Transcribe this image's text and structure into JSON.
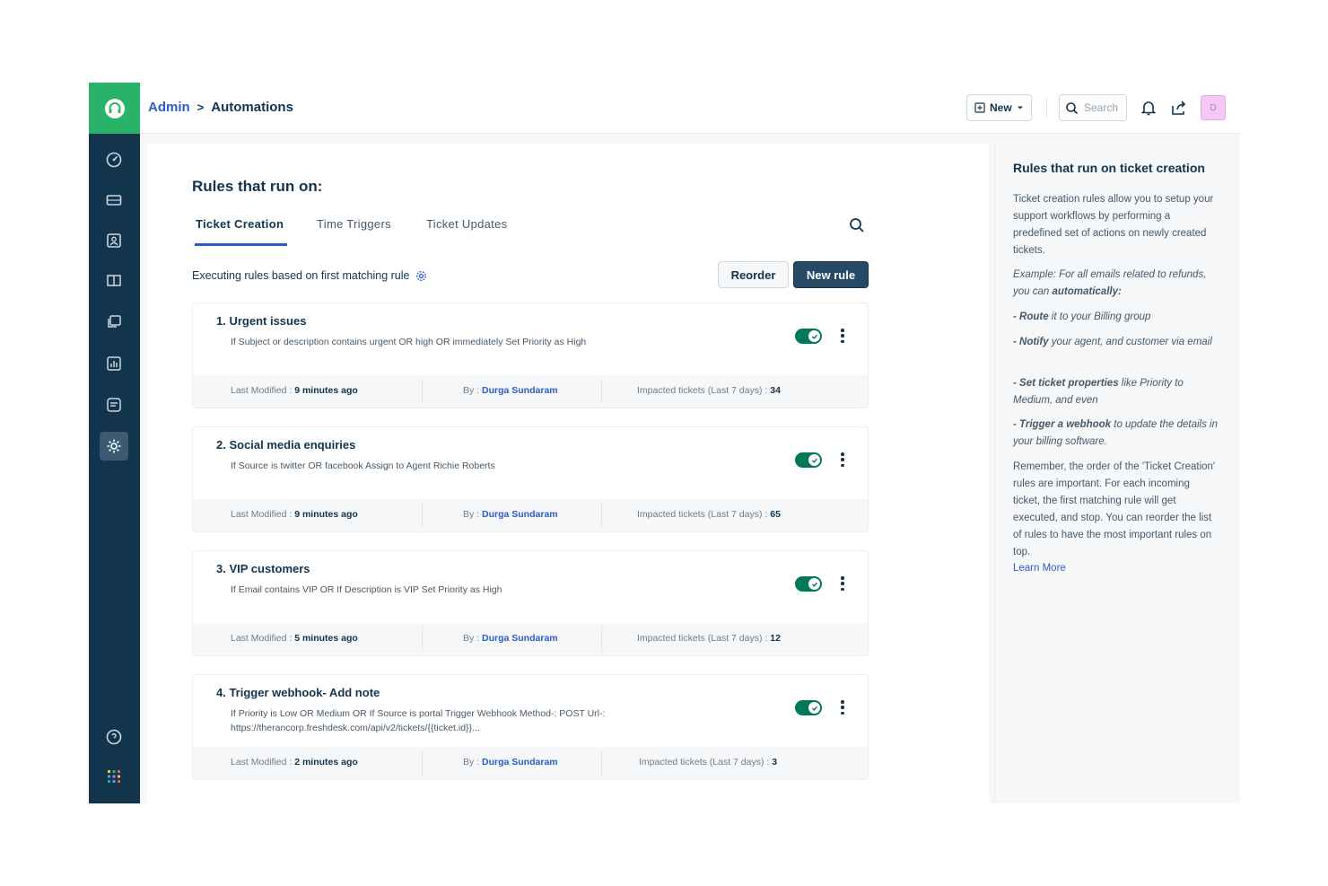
{
  "header": {
    "breadcrumb": {
      "parent": "Admin",
      "separator": ">",
      "current": "Automations"
    },
    "new_label": "New",
    "search_placeholder": "Search",
    "avatar_initial": "D"
  },
  "main": {
    "title": "Rules that run on:",
    "tabs": [
      {
        "label": "Ticket Creation",
        "active": true
      },
      {
        "label": "Time Triggers",
        "active": false
      },
      {
        "label": "Ticket Updates",
        "active": false
      }
    ],
    "exec_text": "Executing rules based on first matching rule",
    "reorder_label": "Reorder",
    "new_rule_label": "New rule",
    "footer_labels": {
      "modified": "Last Modified :",
      "by": "By :",
      "impacted": "Impacted tickets (Last 7 days) :"
    },
    "rules": [
      {
        "name": "1. Urgent issues",
        "condition": "If Subject or description contains urgent OR high OR immediately Set Priority as High",
        "enabled": true,
        "last_modified": "9 minutes ago",
        "by": "Durga Sundaram",
        "impacted": "34"
      },
      {
        "name": "2. Social media enquiries",
        "condition": "If Source is twitter OR facebook Assign to Agent Richie Roberts",
        "enabled": true,
        "last_modified": "9 minutes ago",
        "by": "Durga Sundaram",
        "impacted": "65"
      },
      {
        "name": "3. VIP customers",
        "condition": "If Email contains VIP OR If Description is VIP Set Priority as High",
        "enabled": true,
        "last_modified": "5 minutes ago",
        "by": "Durga Sundaram",
        "impacted": "12"
      },
      {
        "name": "4. Trigger webhook- Add note",
        "condition": "If Priority is Low OR Medium OR If Source is portal Trigger Webhook Method-: POST Url-: https://therancorp.freshdesk.com/api/v2/tickets/{{ticket.id}}...",
        "enabled": true,
        "last_modified": "2 minutes ago",
        "by": "Durga Sundaram",
        "impacted": "3"
      }
    ]
  },
  "help": {
    "title": "Rules that run on ticket creation",
    "intro": "Ticket creation rules allow you to setup your support workflows by performing a predefined set of actions on newly created tickets.",
    "example_prefix": "Example: For all emails related to refunds, you can ",
    "example_bold": "automatically:",
    "bullets": [
      {
        "bold": "- Route",
        "rest": " it to your Billing group"
      },
      {
        "bold": "- Notify",
        "rest": " your agent, and customer via email"
      },
      {
        "bold": "- Set ticket properties",
        "rest": " like Priority to Medium, and even"
      },
      {
        "bold": "- Trigger a webhook",
        "rest": " to update the details in your billing software."
      }
    ],
    "remember": "Remember, the order of the 'Ticket Creation' rules are important. For each incoming ticket, the first matching rule will get executed, and stop. You can reorder the list of rules to have the most important rules on top.",
    "learn_more": "Learn More"
  },
  "colors": {
    "sidebar": "#12344d",
    "brand_green": "#29b36a",
    "accent_blue": "#2c5cc5",
    "toggle_on": "#00795b"
  },
  "icons": {
    "sidebar": [
      "dashboard-icon",
      "tickets-icon",
      "contacts-icon",
      "solutions-icon",
      "forums-icon",
      "reports-icon",
      "discussions-icon",
      "admin-icon",
      "help-icon",
      "apps-grid-icon"
    ],
    "header": [
      "new-icon",
      "search-icon",
      "bell-icon",
      "share-icon"
    ]
  }
}
